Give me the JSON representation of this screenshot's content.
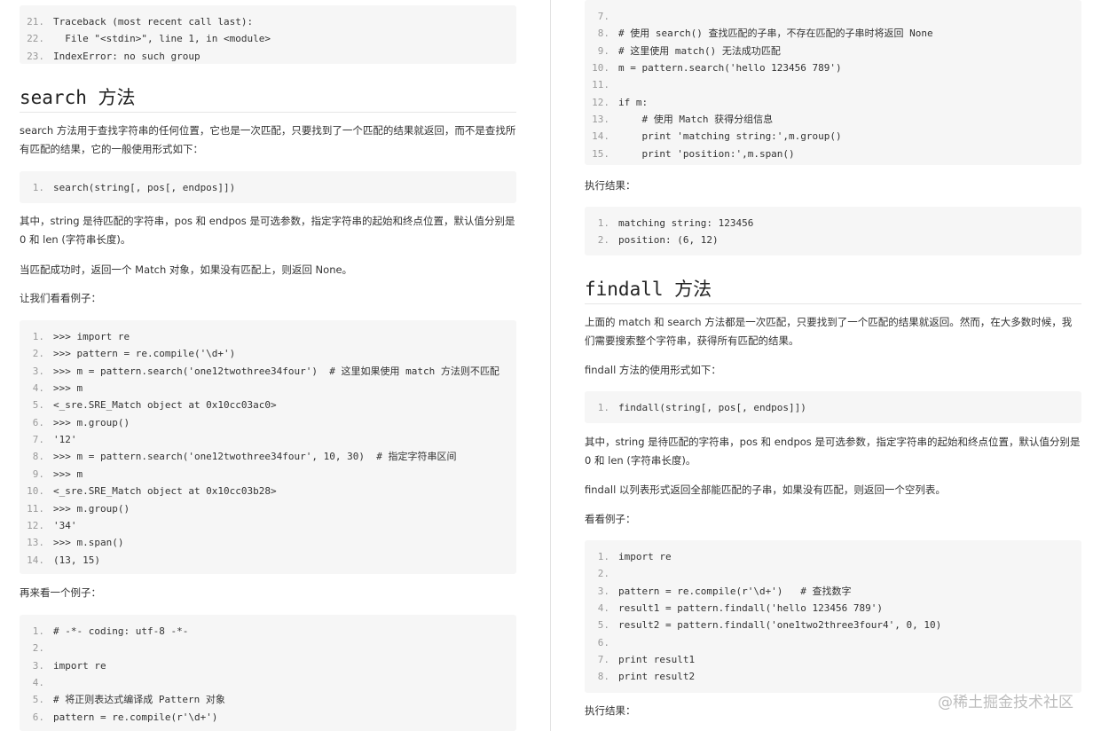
{
  "left": {
    "top_block": [
      "Traceback (most recent call last):",
      "  File \"<stdin>\", line 1, in <module>",
      "IndexError: no such group"
    ],
    "top_block_start": 21,
    "search_heading": "search 方法",
    "search_intro": "search 方法用于查找字符串的任何位置，它也是一次匹配，只要找到了一个匹配的结果就返回，而不是查找所有匹配的结果，它的一般使用形式如下：",
    "search_signature": [
      "search(string[, pos[, endpos]])"
    ],
    "param_text": "其中，string 是待匹配的字符串，pos 和 endpos 是可选参数，指定字符串的起始和终点位置，默认值分别是 0 和 len (字符串长度)。",
    "return_text": "当匹配成功时，返回一个 Match 对象，如果没有匹配上，则返回 None。",
    "example_intro": "让我们看看例子：",
    "example_code": [
      ">>> import re",
      ">>> pattern = re.compile('\\d+')",
      ">>> m = pattern.search('one12twothree34four')  # 这里如果使用 match 方法则不匹配",
      ">>> m",
      "<_sre.SRE_Match object at 0x10cc03ac0>",
      ">>> m.group()",
      "'12'",
      ">>> m = pattern.search('one12twothree34four', 10, 30)  # 指定字符串区间",
      ">>> m",
      "<_sre.SRE_Match object at 0x10cc03b28>",
      ">>> m.group()",
      "'34'",
      ">>> m.span()",
      "(13, 15)"
    ],
    "another_intro": "再来看一个例子：",
    "another_code": [
      "# -*- coding: utf-8 -*-",
      "",
      "import re",
      "",
      "# 将正则表达式编译成 Pattern 对象",
      "pattern = re.compile(r'\\d+')"
    ]
  },
  "right": {
    "top_code": [
      "",
      "# 使用 search() 查找匹配的子串，不存在匹配的子串时将返回 None",
      "# 这里使用 match() 无法成功匹配",
      "m = pattern.search('hello 123456 789')",
      "",
      "if m:",
      "    # 使用 Match 获得分组信息",
      "    print 'matching string:',m.group()",
      "    print 'position:',m.span()"
    ],
    "top_code_start": 7,
    "result_label_1": "执行结果：",
    "result_code": [
      "matching string: 123456",
      "position: (6, 12)"
    ],
    "findall_heading": "findall 方法",
    "findall_intro": "上面的 match 和 search 方法都是一次匹配，只要找到了一个匹配的结果就返回。然而，在大多数时候，我们需要搜索整个字符串，获得所有匹配的结果。",
    "findall_usage": "findall 方法的使用形式如下：",
    "findall_signature": [
      "findall(string[, pos[, endpos]])"
    ],
    "findall_param_text": "其中，string 是待匹配的字符串，pos 和 endpos 是可选参数，指定字符串的起始和终点位置，默认值分别是 0 和 len (字符串长度)。",
    "findall_return_text": "findall 以列表形式返回全部能匹配的子串，如果没有匹配，则返回一个空列表。",
    "look_example": "看看例子：",
    "findall_code": [
      "import re",
      "",
      "pattern = re.compile(r'\\d+')   # 查找数字",
      "result1 = pattern.findall('hello 123456 789')",
      "result2 = pattern.findall('one1two2three3four4', 0, 10)",
      "",
      "print result1",
      "print result2"
    ],
    "result_label_2": "执行结果："
  },
  "watermark": "@稀土掘金技术社区"
}
